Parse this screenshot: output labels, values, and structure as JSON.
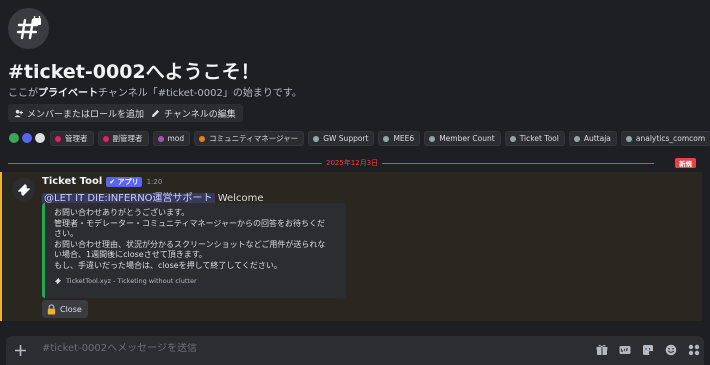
{
  "header": {
    "title": "#ticket-0002へようこそ！",
    "subtitle_pre": "ここが",
    "subtitle_bold": "プライベート",
    "subtitle_post": "チャンネル「#ticket-0002」の始まりです。",
    "actions": [
      {
        "label": "メンバーまたはロールを追加",
        "icon": "add-member-icon"
      },
      {
        "label": "チャンネルの編集",
        "icon": "pencil-icon"
      }
    ]
  },
  "roles": [
    {
      "label": "管理者",
      "color": "#e91e63"
    },
    {
      "label": "副管理者",
      "color": "#e91e63"
    },
    {
      "label": "mod",
      "color": "#9b59b6"
    },
    {
      "label": "コミュニティマネージャー",
      "color": "#e67e22"
    },
    {
      "label": "GW Support",
      "color": "#95a5a6"
    },
    {
      "label": "MEE6",
      "color": "#95a5a6"
    },
    {
      "label": "Member Count",
      "color": "#95a5a6"
    },
    {
      "label": "Ticket Tool",
      "color": "#95a5a6"
    },
    {
      "label": "Auttaja",
      "color": "#95a5a6"
    },
    {
      "label": "analytics_comcom",
      "color": "#95a5a6"
    }
  ],
  "divider": {
    "date": "2025年12月3日",
    "new_badge": "新規"
  },
  "message": {
    "author": "Ticket Tool",
    "app_badge": "✔ アプリ",
    "timestamp": "1:20",
    "mention": "@LET IT DIE:INFERNO運営サポート",
    "text": " Welcome",
    "embed_lines": [
      "お問い合わせありがとうございます。",
      "管理者・モデレーター・コミュニティマネージャーからの回答をお待ちくだ",
      "さい。",
      "お問い合わせ理由、状況が分かるスクリーンショットなどご用件が送られな",
      "い場合、1週間後にcloseさせて頂きます。",
      "もし、手違いだった場合は、closeを押して終了してください。"
    ],
    "embed_footer": "TicketTool.xyz - Ticketing without clutter",
    "close_button": "Close"
  },
  "composer": {
    "placeholder": "#ticket-0002へメッセージを送信",
    "icons": [
      "gift-icon",
      "gif-icon",
      "sticker-icon",
      "emoji-icon",
      "apps-icon"
    ]
  }
}
